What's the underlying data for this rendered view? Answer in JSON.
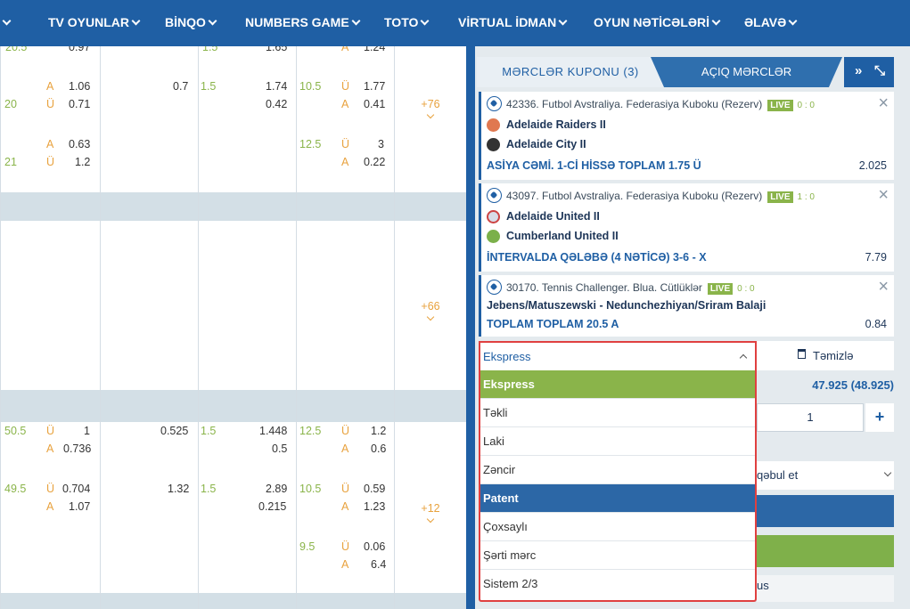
{
  "nav": {
    "items": [
      {
        "label": "TV OYUNLAR"
      },
      {
        "label": "BİNQO"
      },
      {
        "label": "NUMBERS GAME"
      },
      {
        "label": "TOTO"
      },
      {
        "label": "VİRTUAL İDMAN"
      },
      {
        "label": "OYUN NƏTİCƏLƏRİ"
      },
      {
        "label": "ƏLAVƏ"
      }
    ]
  },
  "grid": {
    "r0": {
      "a1": "20.5",
      "b1": "0.97",
      "c1": "1.5",
      "d1": "1.65",
      "e1": "A",
      "f1": "1.24"
    },
    "r1": {
      "b1": "A",
      "b1v": "1.06",
      "c1": "0.7",
      "d1": "1.5",
      "d1v": "1.74",
      "e1": "10.5",
      "f1": "Ü",
      "f1v": "1.77",
      "a2": "20",
      "b2": "Ü",
      "b2v": "0.71",
      "d2v": "0.42",
      "f2": "A",
      "f2v": "0.41",
      "more": "+76"
    },
    "r2": {
      "b1": "A",
      "b1v": "0.63",
      "e1": "12.5",
      "f1": "Ü",
      "f1v": "3",
      "a2": "21",
      "b2": "Ü",
      "b2v": "1.2",
      "f2": "A",
      "f2v": "0.22"
    },
    "r3": {
      "more": "+66"
    },
    "r4": {
      "a1": "50.5",
      "b1": "Ü",
      "b1v": "1",
      "c1": "0.525",
      "d1": "1.5",
      "d1v": "1.448",
      "e1": "12.5",
      "f1": "Ü",
      "f1v": "1.2",
      "b2": "A",
      "b2v": "0.736",
      "d2v": "0.5",
      "f2": "A",
      "f2v": "0.6"
    },
    "r5": {
      "a1": "49.5",
      "b1": "Ü",
      "b1v": "0.704",
      "c1": "1.32",
      "d1": "1.5",
      "d1v": "2.89",
      "e1": "10.5",
      "f1": "Ü",
      "f1v": "0.59",
      "b2": "A",
      "b2v": "1.07",
      "d2v": "0.215",
      "f2": "A",
      "f2v": "1.23",
      "more": "+12"
    },
    "r6": {
      "e1": "9.5",
      "f1": "Ü",
      "f1v": "0.06",
      "f2": "A",
      "f2v": "6.4"
    }
  },
  "panel": {
    "tab_coupon": "MƏRCLƏR KUPONU (3)",
    "tab_open": "AÇIQ MƏRCLƏR",
    "expand_icon": "»",
    "collapse_icon": "⤡",
    "bets": [
      {
        "header": "42336. Futbol Avstraliya. Federasiya Kuboku (Rezerv)",
        "live": "LIVE",
        "score": "0 : 0",
        "team1": "Adelaide Raiders II",
        "team2": "Adelaide City II",
        "market": "ASİYA CƏMİ. 1-Cİ HİSSƏ TOPLAM 1.75 Ü",
        "odd": "2.025"
      },
      {
        "header": "43097. Futbol Avstraliya. Federasiya Kuboku (Rezerv)",
        "live": "LIVE",
        "score": "1 : 0",
        "team1": "Adelaide United II",
        "team2": "Cumberland United II",
        "market": "İNTERVALDA QƏLƏBƏ (4 NƏTİCƏ) 3-6 - X",
        "odd": "7.79"
      },
      {
        "header": "30170. Tennis Challenger. Blua. Cütlüklər",
        "live": "LIVE",
        "score": "0 : 0",
        "team1": "Jebens/Matuszewski - Nedunchezhiyan/Sriram Balaji",
        "market": "TOPLAM TOPLAM 20.5 A",
        "odd": "0.84"
      }
    ],
    "clear_label": "Təmizlə",
    "total": "47.925 (48.925)",
    "stake": "1",
    "plus": "+",
    "accept_label": "qəbul et",
    "bonus_label": "us"
  },
  "dropdown": {
    "selected": "Ekspress",
    "options": [
      "Ekspress",
      "Təkli",
      "Laki",
      "Zəncir",
      "Patent",
      "Çoxsaylı",
      "Şərti mərc",
      "Sistem 2/3"
    ]
  },
  "colors": {
    "nav": "#1f5fa4",
    "green": "#8ab44a",
    "orange": "#e8a23e",
    "highlight_border": "#e04040"
  }
}
